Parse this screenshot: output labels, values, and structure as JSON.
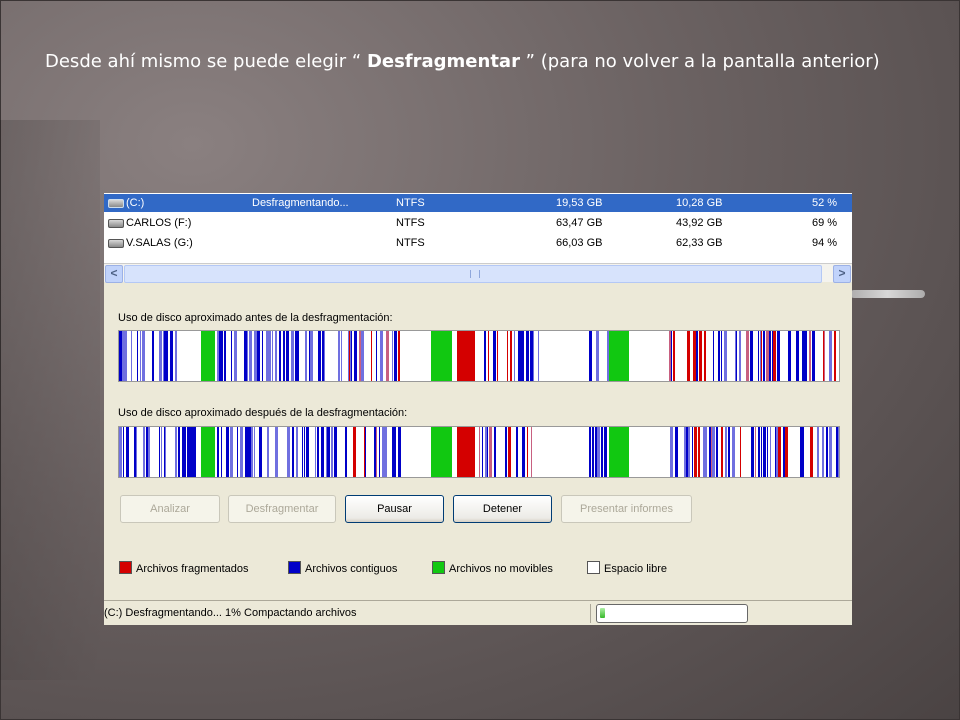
{
  "caption": {
    "before": "Desde ahí mismo se puede elegir “ ",
    "bold": "Desfragmentar",
    "after": " ” (para no  volver a la pantalla anterior)"
  },
  "volumes": [
    {
      "name": "(C:)",
      "status": "Desfragmentando...",
      "fs": "NTFS",
      "capacity": "19,53 GB",
      "free": "10,28 GB",
      "pct": "52 %",
      "selected": true
    },
    {
      "name": "CARLOS (F:)",
      "status": "",
      "fs": "NTFS",
      "capacity": "63,47 GB",
      "free": "43,92 GB",
      "pct": "69 %",
      "selected": false
    },
    {
      "name": "V.SALAS (G:)",
      "status": "",
      "fs": "NTFS",
      "capacity": "66,03 GB",
      "free": "62,33 GB",
      "pct": "94 %",
      "selected": false
    }
  ],
  "scrollbar": {
    "left_arrow": "<",
    "right_arrow": ">"
  },
  "map_before_label": "Uso de disco aproximado antes de la desfragmentación:",
  "map_after_label": "Uso de disco aproximado después de la desfragmentación:",
  "buttons": [
    {
      "label": "Analizar",
      "enabled": false
    },
    {
      "label": "Desfragmentar",
      "enabled": false
    },
    {
      "label": "Pausar",
      "enabled": true
    },
    {
      "label": "Detener",
      "enabled": true
    },
    {
      "label": "Presentar informes",
      "enabled": false
    }
  ],
  "legend": [
    {
      "label": "Archivos fragmentados",
      "color": "#d40000"
    },
    {
      "label": "Archivos contiguos",
      "color": "#0000c8"
    },
    {
      "label": "Archivos no movibles",
      "color": "#11c811"
    },
    {
      "label": "Espacio libre",
      "color": "#ffffff"
    }
  ],
  "status_text": "(C:) Desfragmentando... 1%  Compactando archivos",
  "progress": 0.01,
  "colors": {
    "fragmented": "#d40000",
    "contiguous": "#0000c8",
    "unmovable": "#11c811",
    "contiguous_light": "#7070e0",
    "fragmented_light": "#c86080"
  }
}
